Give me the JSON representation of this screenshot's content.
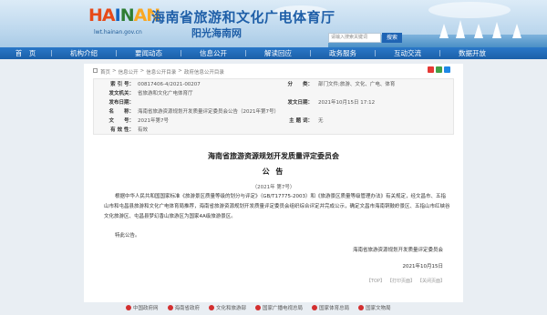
{
  "header": {
    "logo_letters": [
      "HA",
      "I",
      "N",
      "AN"
    ],
    "logo_sub": "lwt.hainan.gov.cn",
    "site_title": "海南省旅游和文化广电体育厅",
    "site_sub": "阳光海南网",
    "search_placeholder": "请输入搜索关键词",
    "search_button": "搜索"
  },
  "nav": {
    "items": [
      "首　页",
      "机构介绍",
      "要闻动态",
      "信息公开",
      "解读回应",
      "政务服务",
      "互动交流",
      "数据开放"
    ]
  },
  "breadcrumb": [
    "首页",
    ">",
    "信息公开",
    ">",
    "信息公开目录",
    ">",
    "政府信息公开目录"
  ],
  "meta": {
    "rows": [
      {
        "k1": "索 引 号：",
        "v1": "00817406-4/2021-00207",
        "k2": "分　　类：",
        "v2": "部门文件;旅游、文化、广电、体育"
      },
      {
        "k1": "发文机关：",
        "v1": "省旅游和文化广电体育厅",
        "k2": "",
        "v2": ""
      },
      {
        "k1": "发布日期：",
        "v1": "",
        "k2": "发文日期：",
        "v2": "2021年10月15日 17:12"
      },
      {
        "k1": "名　　称：",
        "v1": "海南省旅游资源规划开发质量评定委员会公告（2021年第7号）",
        "k2": "",
        "v2": ""
      },
      {
        "k1": "文　　号：",
        "v1": "2021年第7号",
        "k2": "主 题 词：",
        "v2": "无"
      },
      {
        "k1": "有 效 性：",
        "v1": "有效",
        "k2": "",
        "v2": ""
      }
    ]
  },
  "article": {
    "title": "海南省旅游资源规划开发质量评定委员会",
    "notice": "公  告",
    "number": "（2021年 第7号）",
    "para1": "根据中华人民共和国国家标准《旅游景区质量等级的划分与评定》（GB/T17775-2003）和《旅游景区质量等级管理办法》有关规定，经文昌市、五指山市和屯昌县旅游和文化广电体育局推荐，海南省旅游资源规划开发质量评定委员会组织综合评定并完成公示，确定文昌市海南铜鼓岭景区、五指山市红峡谷文化旅游区、屯昌县梦幻香山旅游区为国家4A级旅游景区。",
    "para2": "特此公告。",
    "signer": "海南省旅游资源规划开发质量评定委员会",
    "date": "2021年10月15日",
    "bottom_links": [
      "【TOP】",
      "【打印页面】",
      "【关闭页面】"
    ]
  },
  "footer": {
    "links": [
      "中国政府网",
      "海南省政府",
      "文化和旅游部",
      "国家广播电视总局",
      "国家体育总局",
      "国家文物局"
    ]
  },
  "colors": {
    "primary": "#1f64b4",
    "nav": "#1b5fa8",
    "card": "#ffffff",
    "page_bg": "#e9eef3"
  }
}
